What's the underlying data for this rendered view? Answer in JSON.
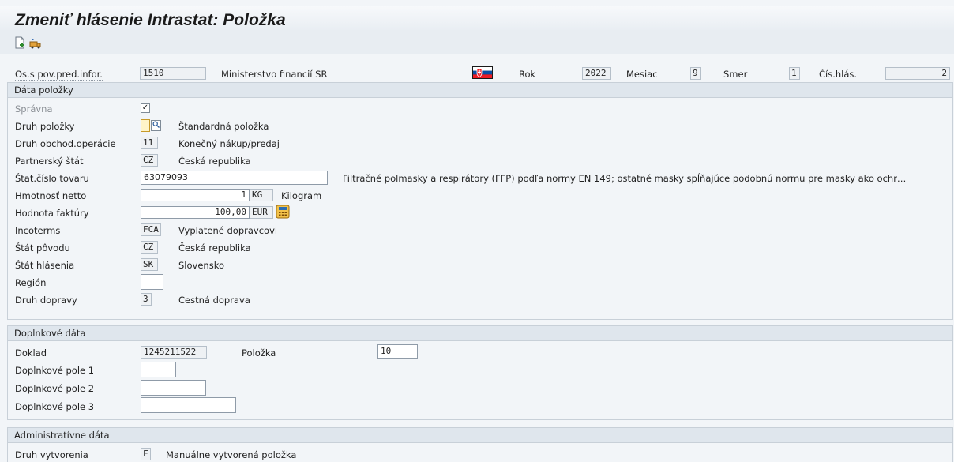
{
  "title": "Zmeniť hlásenie Intrastat: Položka",
  "toolbar": {
    "icons": [
      "new-document-icon",
      "transport-icon"
    ]
  },
  "header": {
    "org_label": "Os.s pov.pred.infor.",
    "org_value": "1510",
    "org_text": "Ministerstvo financií SR",
    "flag": "slovakia-flag-icon",
    "year_label": "Rok",
    "year_value": "2022",
    "month_label": "Mesiac",
    "month_value": "9",
    "dir_label": "Smer",
    "dir_value": "1",
    "num_label": "Čís.hlás.",
    "num_value": "2"
  },
  "item_data": {
    "title": "Dáta položky",
    "spravna_label": "Správna",
    "spravna_checked": true,
    "item_type_label": "Druh položky",
    "item_type_text": "Štandardná položka",
    "trade_label": "Druh obchod.operácie",
    "trade_value": "11",
    "trade_text": "Konečný nákup/predaj",
    "partner_label": "Partnerský štát",
    "partner_value": "CZ",
    "partner_text": "Česká republika",
    "commodity_label": "Štat.číslo tovaru",
    "commodity_value": "63079093",
    "commodity_text": "Filtračné polmasky a respirátory (FFP) podľa normy EN 149; ostatné masky spĺňajúce podobnú normu pre masky ako ochr…",
    "weight_label": "Hmotnosť netto",
    "weight_value": "1",
    "weight_unit": "KG",
    "weight_unit_text": "Kilogram",
    "invoice_label": "Hodnota faktúry",
    "invoice_value": "100,00",
    "invoice_currency": "EUR",
    "incoterms_label": "Incoterms",
    "incoterms_value": "FCA",
    "incoterms_text": "Vyplatené dopravcovi",
    "origin_label": "Štát pôvodu",
    "origin_value": "CZ",
    "origin_text": "Česká republika",
    "report_state_label": "Štát hlásenia",
    "report_state_value": "SK",
    "report_state_text": "Slovensko",
    "region_label": "Región",
    "region_value": "",
    "transport_label": "Druh dopravy",
    "transport_value": "3",
    "transport_text": "Cestná doprava"
  },
  "additional": {
    "title": "Doplnkové dáta",
    "doc_label": "Doklad",
    "doc_value": "1245211522",
    "item_label": "Položka",
    "item_value": "10",
    "f1_label": "Doplnkové pole 1",
    "f1_value": "",
    "f2_label": "Doplnkové pole 2",
    "f2_value": "",
    "f3_label": "Doplnkové pole 3",
    "f3_value": ""
  },
  "admin": {
    "title": "Administratívne dáta",
    "creation_label": "Druh vytvorenia",
    "creation_value": "F",
    "creation_text": "Manuálne vytvorená položka"
  },
  "colors": {
    "background": "#f2f5f8",
    "section_header": "#dfe6ed",
    "field_border": "#8f9ba8"
  }
}
